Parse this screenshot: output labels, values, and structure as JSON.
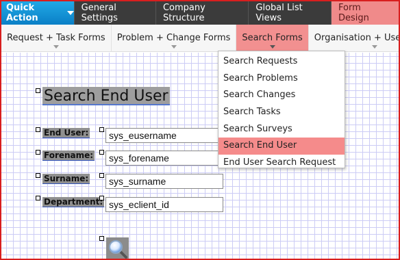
{
  "topnav": {
    "quick_action": "Quick Action",
    "items": [
      "General Settings",
      "Company Structure",
      "Global List Views"
    ],
    "active": "Form Design"
  },
  "subnav": {
    "items": [
      "Request + Task Forms",
      "Problem + Change Forms",
      "Search Forms",
      "Organisation + User Forms"
    ],
    "active_index": 2
  },
  "dropdown": {
    "items": [
      "Search Requests",
      "Search Problems",
      "Search Changes",
      "Search Tasks",
      "Search Surveys",
      "Search End User",
      "End User Search Request"
    ],
    "selected_index": 5
  },
  "form": {
    "title": "Search End User",
    "fields": [
      {
        "label": "End User:",
        "value": "sys_eusername"
      },
      {
        "label": "Forename:",
        "value": "sys_forename"
      },
      {
        "label": "Surname:",
        "value": "sys_surname"
      },
      {
        "label": "Department:",
        "value": "sys_eclient_id"
      }
    ],
    "search_button_icon": "magnifier-icon"
  },
  "colors": {
    "frame": "#d81e1e",
    "quick_action": "#0a7fc6",
    "active_tab": "#f08a8a",
    "grid": "#ccccf5"
  }
}
